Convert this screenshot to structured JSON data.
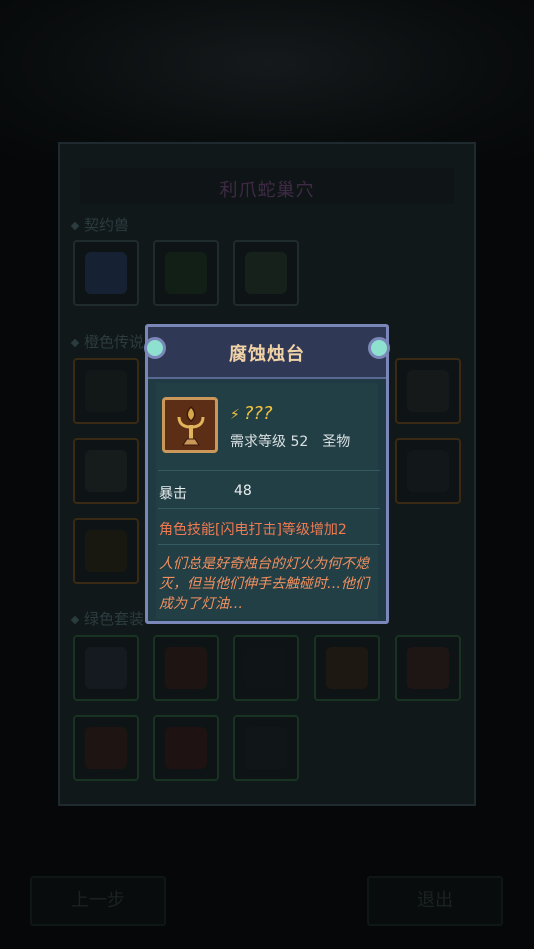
{
  "background": {
    "panel_title": "利爪蛇巢穴",
    "sections": [
      {
        "label": "契约兽"
      },
      {
        "label": "橙色传说"
      },
      {
        "label": "绿色套装"
      }
    ],
    "buttons": {
      "prev": "上一步",
      "exit": "退出"
    }
  },
  "tooltip": {
    "title": "腐蚀烛台",
    "item_name": "???",
    "bolt_icon": "bolt-icon",
    "req_label": "需求等级",
    "req_level": "52",
    "item_type": "圣物",
    "stat_label": "暴击",
    "stat_value": "48",
    "skill_text": "角色技能[闪电打击]等级增加2",
    "lore_text": "人们总是好奇烛台的灯火为何不熄灭，但当他们伸手去触碰时…他们成为了灯油…"
  },
  "colors": {
    "tooltip_frame": "#7a87b8",
    "tooltip_bg": "#1f3a42",
    "title_gold": "#f2d3a8",
    "name_gold": "#f1c23d",
    "skill_orange": "#f07a52"
  }
}
